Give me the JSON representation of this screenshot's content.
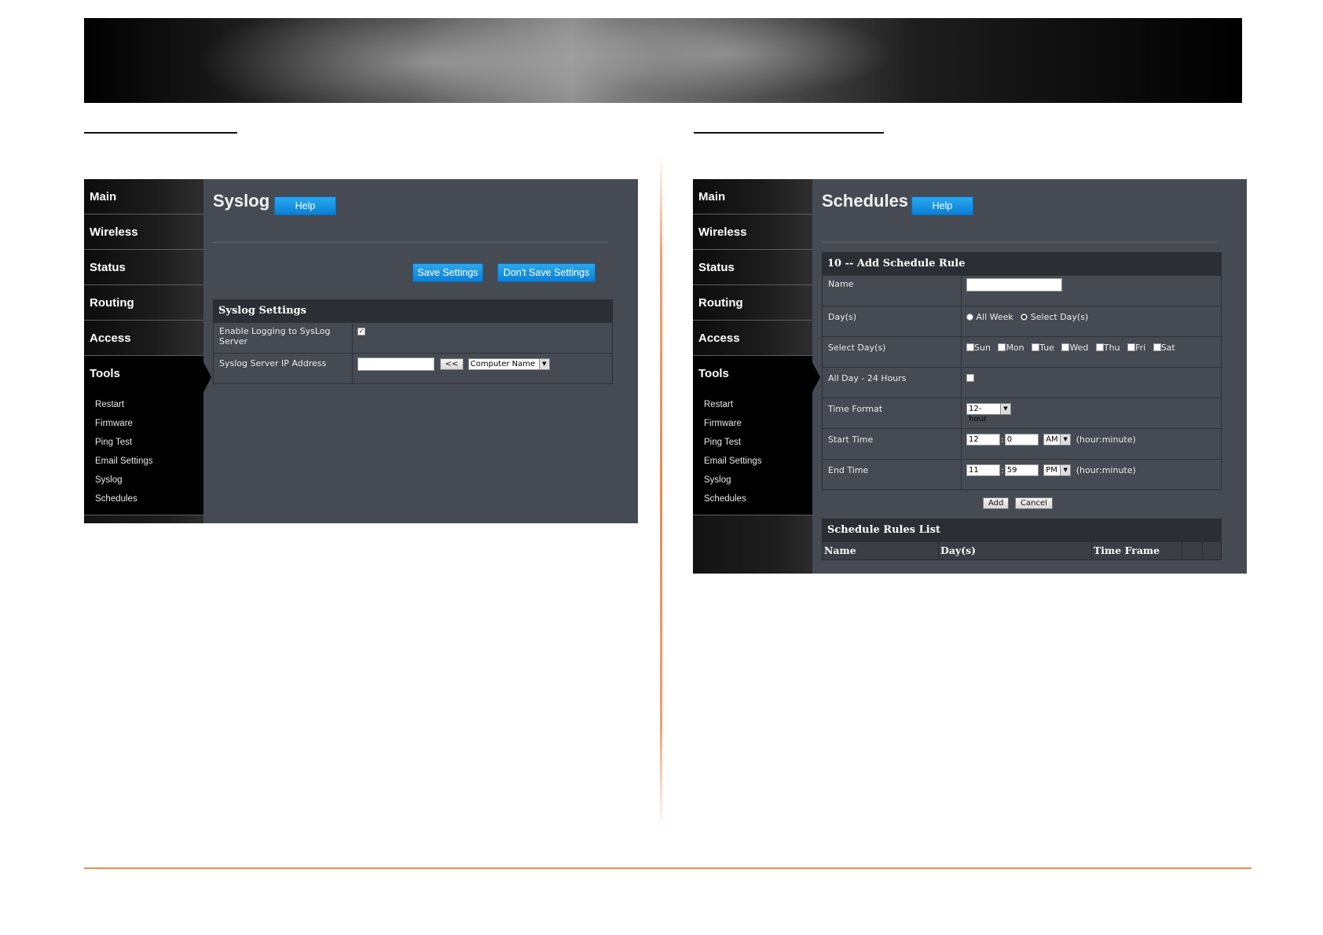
{
  "nav": {
    "main_items": [
      "Main",
      "Wireless",
      "Status",
      "Routing",
      "Access"
    ],
    "tools": "Tools",
    "tools_items": [
      "Restart",
      "Firmware",
      "Ping Test",
      "Email Settings",
      "Syslog",
      "Schedules"
    ]
  },
  "syslog": {
    "title": "Syslog",
    "help": "Help",
    "save": "Save Settings",
    "dont_save": "Don't Save Settings",
    "panel_title": "Syslog Settings",
    "enable_label": "Enable Logging to SysLog Server",
    "enable_checked": "✓",
    "server_ip_label": "Syslog Server IP Address",
    "server_ip_value": "",
    "arrow_button": "<<",
    "computer_name": "Computer Name"
  },
  "schedules": {
    "title": "Schedules",
    "help": "Help",
    "panel_title": "10 -- Add Schedule Rule",
    "name_label": "Name",
    "name_value": "",
    "days_label": "Day(s)",
    "all_week": "All Week",
    "select_days": "Select Day(s)",
    "select_days_label": "Select Day(s)",
    "weekdays": [
      "Sun",
      "Mon",
      "Tue",
      "Wed",
      "Thu",
      "Fri",
      "Sat"
    ],
    "all_day_label": "All Day - 24 Hours",
    "time_format_label": "Time Format",
    "time_format_value": "12-hour",
    "start_label": "Start Time",
    "start_hour": "12",
    "start_minute": "0",
    "start_ampm": "AM",
    "end_label": "End Time",
    "end_hour": "11",
    "end_minute": "59",
    "end_ampm": "PM",
    "hour_minute": "(hour:minute)",
    "colon": ":",
    "add": "Add",
    "cancel": "Cancel",
    "list_title": "Schedule Rules List",
    "list_cols": [
      "Name",
      "Day(s)",
      "Time Frame"
    ]
  },
  "colors": {
    "accent_orange": "#e98a4c",
    "button_blue": "#1a93e2",
    "panel_bg": "#464b53"
  }
}
